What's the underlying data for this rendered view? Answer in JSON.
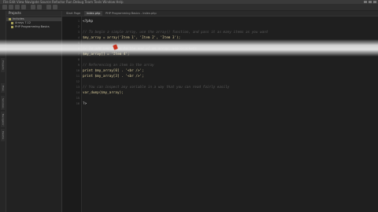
{
  "titlebar": {
    "menu": "File  Edit  View  Navigate  Source  Refactor  Run  Debug  Team  Tools  Window  Help"
  },
  "sidebar": {
    "vertical_tabs": [
      "Projects",
      "Files",
      "Services",
      "Navigator",
      "Palette"
    ]
  },
  "projects_panel": {
    "title": "Projects",
    "items": [
      {
        "label": "Includes",
        "selected": true
      },
      {
        "label": "Arrays 7.12"
      },
      {
        "label": "PHP Programming Basics"
      }
    ]
  },
  "editor": {
    "tabs": [
      {
        "label": "Start Page",
        "active": false
      },
      {
        "label": "index.php",
        "active": true
      },
      {
        "label": "PHP Programming Basics - index.php",
        "active": false
      }
    ],
    "lines": [
      {
        "num": "1",
        "text": "<?php",
        "kind": "tag"
      },
      {
        "num": "2",
        "text": "",
        "kind": "code"
      },
      {
        "num": "3",
        "text": "// To begin a simple array, use the array() function, and pass it as many items as you want",
        "kind": "comment"
      },
      {
        "num": "4",
        "text": "$my_array = array('Item 1', 'Item 2', 'Item 3');",
        "kind": "code"
      },
      {
        "num": "5",
        "text": "",
        "kind": "code"
      },
      {
        "num": "6",
        "text": "// To add new items to the end of an array, use brackets",
        "kind": "comment"
      },
      {
        "num": "7",
        "text": "$my_array[] = 'Item 4';",
        "kind": "code"
      },
      {
        "num": "8",
        "text": "",
        "kind": "code"
      },
      {
        "num": "9",
        "text": "// Referencing an item in the array",
        "kind": "comment"
      },
      {
        "num": "10",
        "text": "print $my_array[0] . '<br />';",
        "kind": "code"
      },
      {
        "num": "11",
        "text": "print $my_array[3] . '<br />';",
        "kind": "code"
      },
      {
        "num": "12",
        "text": "",
        "kind": "code"
      },
      {
        "num": "13",
        "text": "// You can inspect any variable in a way that you can read fairly easily",
        "kind": "comment"
      },
      {
        "num": "14",
        "text": "var_dump($my_array);",
        "kind": "code"
      },
      {
        "num": "15",
        "text": "",
        "kind": "code"
      },
      {
        "num": "16",
        "text": "?>",
        "kind": "tag"
      }
    ]
  },
  "colors": {
    "background": "#1e1e1e",
    "comment": "#5a5a5a",
    "code": "#d6c99a",
    "cursor_marker": "#c8321e"
  }
}
